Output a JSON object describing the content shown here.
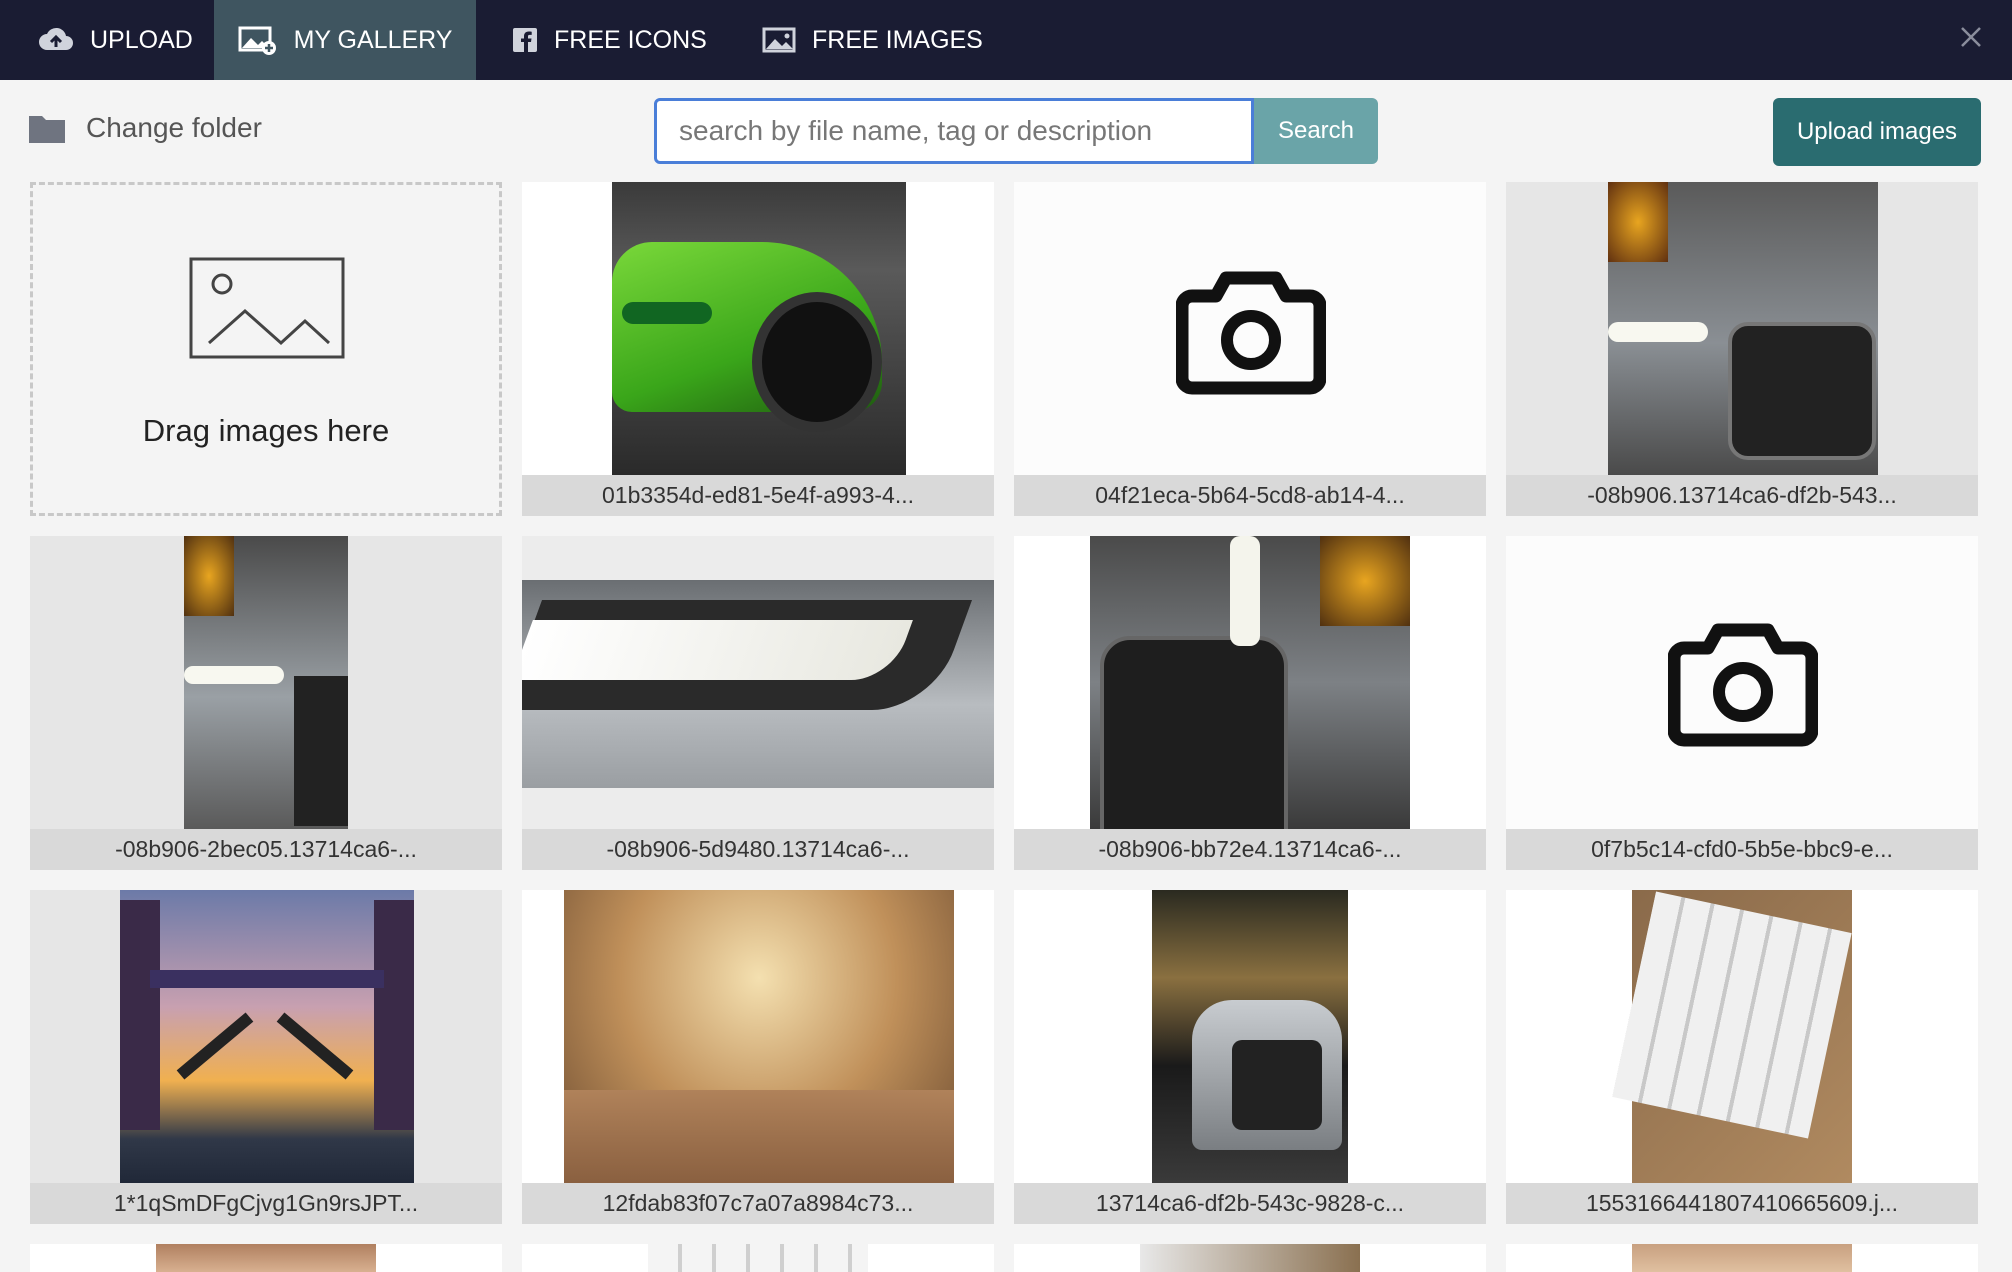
{
  "tabs": [
    {
      "label": "UPLOAD",
      "icon": "cloud-upload-icon"
    },
    {
      "label": "MY GALLERY",
      "icon": "gallery-add-icon",
      "active": true
    },
    {
      "label": "FREE ICONS",
      "icon": "facebook-square-icon"
    },
    {
      "label": "FREE IMAGES",
      "icon": "image-icon"
    }
  ],
  "toolbar": {
    "folder_label": "Change folder",
    "search_placeholder": "search by file name, tag or description",
    "search_value": "",
    "search_label": "Search",
    "upload_label": "Upload images"
  },
  "dropzone": {
    "label": "Drag images here"
  },
  "gallery": {
    "items": [
      {
        "caption": "01b3354d-ed81-5e4f-a993-4..."
      },
      {
        "caption": "04f21eca-5b64-5cd8-ab14-4..."
      },
      {
        "caption": "-08b906.13714ca6-df2b-543..."
      },
      {
        "caption": "-08b906-2bec05.13714ca6-..."
      },
      {
        "caption": "-08b906-5d9480.13714ca6-..."
      },
      {
        "caption": "-08b906-bb72e4.13714ca6-..."
      },
      {
        "caption": "0f7b5c14-cfd0-5b5e-bbc9-e..."
      },
      {
        "caption": "1*1qSmDFgCjvg1Gn9rsJPT..."
      },
      {
        "caption": "12fdab83f07c7a07a8984c73..."
      },
      {
        "caption": "13714ca6-df2b-543c-9828-c..."
      },
      {
        "caption": "1553166441807410665609.j..."
      }
    ]
  },
  "colors": {
    "topbar": "#1a1c33",
    "active_tab": "#3f5560",
    "search_button": "#6aa4a8",
    "upload_button": "#2a6c70",
    "caption_bg": "#d9d9d9",
    "search_border": "#4a7ed8"
  }
}
